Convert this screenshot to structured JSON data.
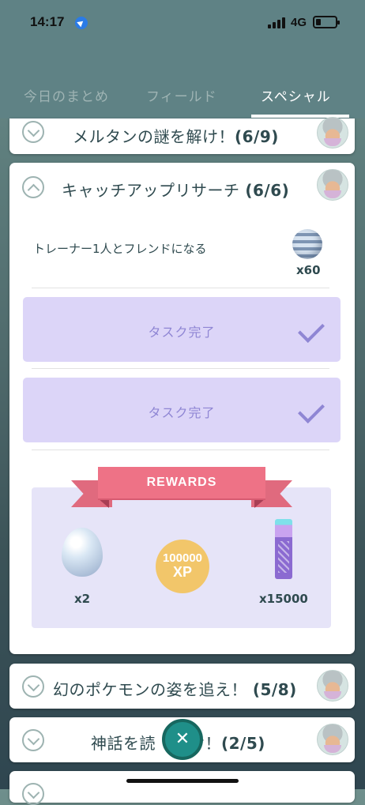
{
  "status_bar": {
    "time": "14:17",
    "network": "4G"
  },
  "tabs": [
    {
      "label": "今日のまとめ",
      "active": false
    },
    {
      "label": "フィールド",
      "active": false
    },
    {
      "label": "スペシャル",
      "active": true
    }
  ],
  "research_cards": [
    {
      "title": "メルタンの謎を解け！",
      "progress": "(6/9)",
      "expanded": false
    },
    {
      "title": "キャッチアップリサーチ",
      "progress": "(6/6)",
      "expanded": true
    },
    {
      "title": "幻のポケモンの姿を追え！",
      "progress": "(5/8)",
      "expanded": false
    },
    {
      "title": "神話を読",
      "title_suffix": "け！",
      "progress": "(2/5)",
      "expanded": false
    }
  ],
  "expanded_card": {
    "task": {
      "text": "トレーナー1人とフレンドになる",
      "reward_qty": "x60",
      "reward_icon": "great-ball-icon"
    },
    "completed_tasks": [
      {
        "label": "タスク完了"
      },
      {
        "label": "タスク完了"
      }
    ],
    "rewards": {
      "banner": "REWARDS",
      "items": [
        {
          "icon": "egg-icon",
          "qty": "x2"
        },
        {
          "icon": "xp-icon",
          "amount": "100000",
          "unit": "XP"
        },
        {
          "icon": "stardust-icon",
          "qty": "x15000"
        }
      ]
    }
  },
  "colors": {
    "header": "#5f8285",
    "completed_task": "#dcd5f8",
    "accent": "#8f86d4",
    "ribbon": "#ee7286"
  }
}
